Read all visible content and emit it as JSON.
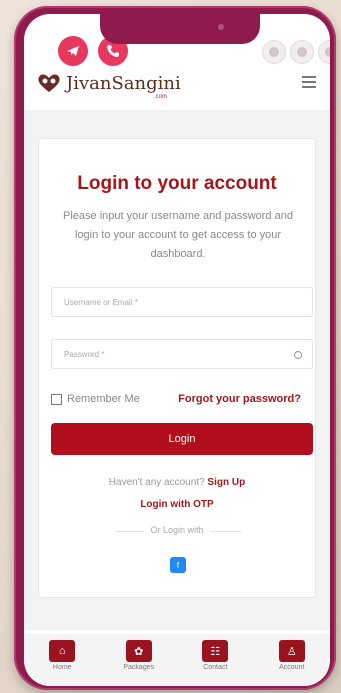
{
  "header": {
    "brand": "JivanSangini",
    "brand_sub": ".com"
  },
  "login": {
    "title": "Login to your account",
    "description": "Please input your username and password and login to your account to get access to your dashboard.",
    "username_placeholder": "Username or Email *",
    "password_placeholder": "Password *",
    "remember_label": "Remember Me",
    "forgot_label": "Forgot your password?",
    "login_button": "Login",
    "signup_prefix": "Haven't any account?",
    "signup_link": "Sign Up",
    "otp_link": "Login with OTP",
    "or_label": "Or Login with",
    "social_label": "f"
  },
  "nav": [
    {
      "label": "Home",
      "icon": "⌂"
    },
    {
      "label": "Packages",
      "icon": "✿"
    },
    {
      "label": "Contact",
      "icon": "☷"
    },
    {
      "label": "Account",
      "icon": "♙"
    }
  ],
  "colors": {
    "accent": "#a3171d",
    "frame": "#8e1a4e",
    "button": "#b10f1e"
  }
}
